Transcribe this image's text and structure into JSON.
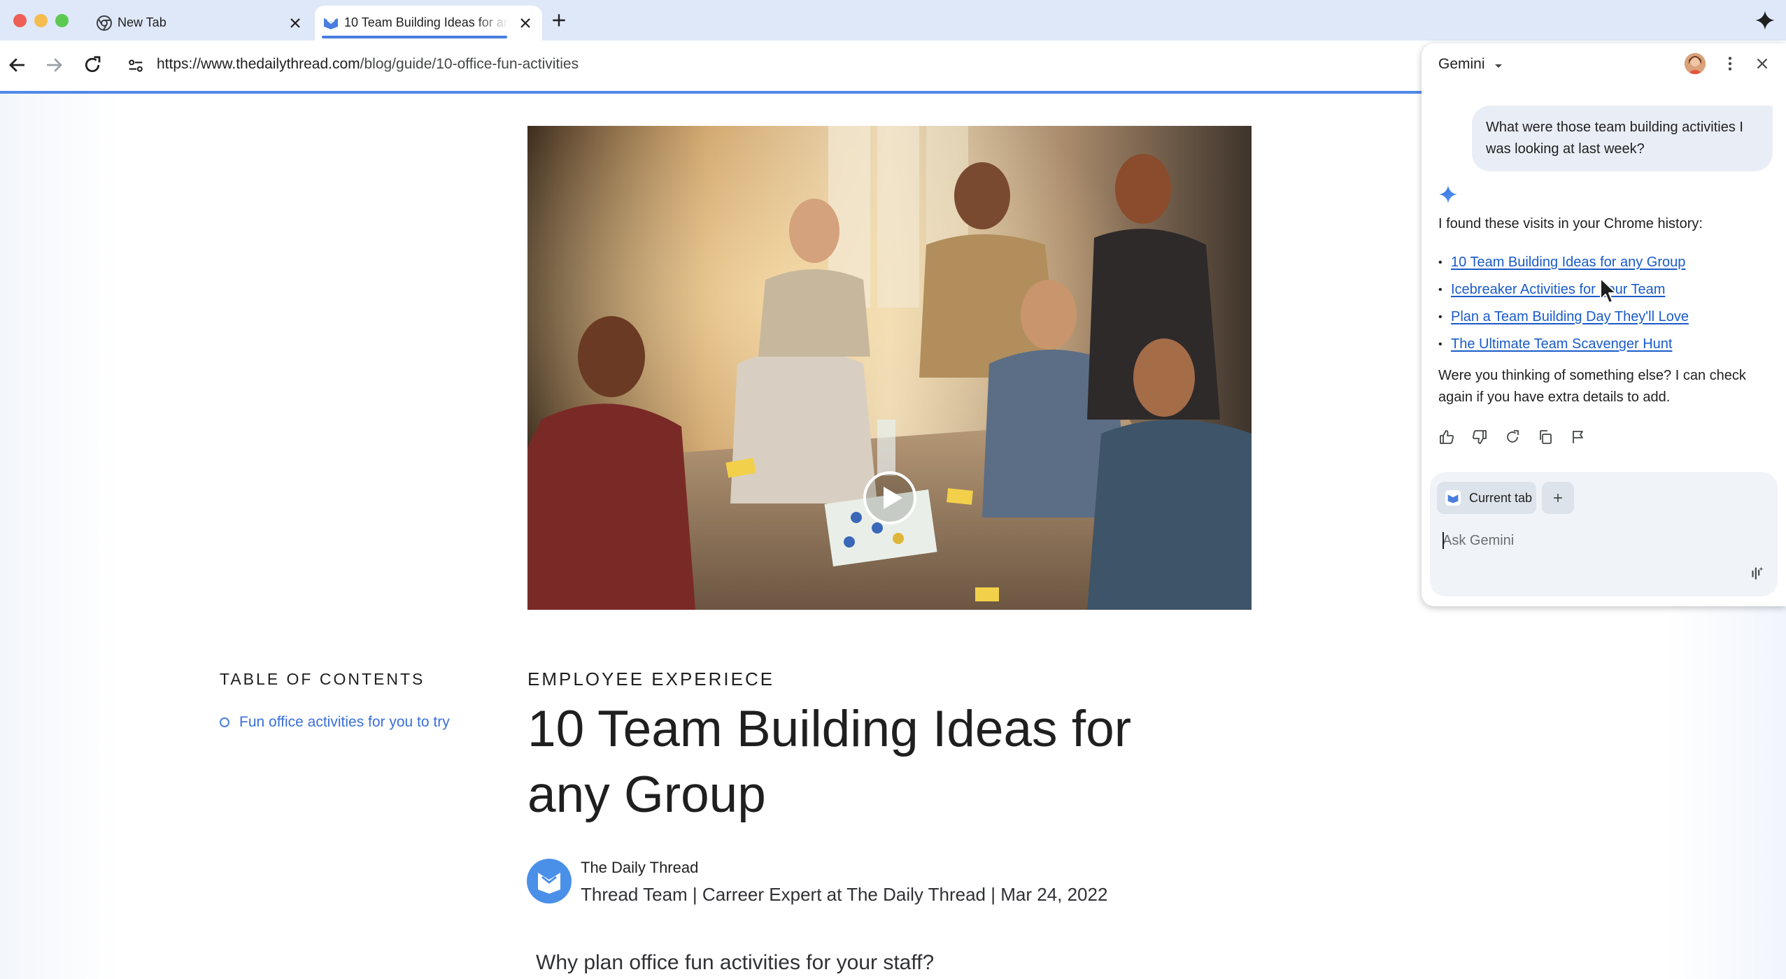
{
  "browser": {
    "tabs": [
      {
        "title": "New Tab",
        "active": false
      },
      {
        "title": "10 Team Building Ideas for any Group",
        "active": true
      }
    ],
    "url": {
      "host": "https://www.thedailythread.com",
      "path": "/blog/guide/10-office-fun-activities"
    }
  },
  "article": {
    "toc": {
      "heading": "TABLE OF CONTENTS",
      "items": [
        "Fun office activities for you to try"
      ]
    },
    "kicker": "EMPLOYEE EXPERIECE",
    "title": "10 Team Building Ideas for any Group",
    "author": {
      "name": "The Daily Thread",
      "meta": "Thread Team | Carreer Expert at The Daily Thread | Mar 24, 2022"
    },
    "subheading": "Why plan office fun activities for your staff?"
  },
  "gemini": {
    "title": "Gemini",
    "user_message": "What were those team building activities I was looking at last week?",
    "response_intro": "I found these visits in your Chrome history:",
    "links": [
      "10 Team Building Ideas for any Group",
      "Icebreaker Activities for Your Team",
      "Plan a Team Building Day They'll Love",
      "The Ultimate Team Scavenger Hunt"
    ],
    "followup": "Were you thinking of something else? I can check again if you have extra details to add.",
    "context_chip": "Current tab",
    "input_placeholder": "Ask Gemini"
  },
  "colors": {
    "accent": "#4a7de0",
    "link": "#1a5bc9",
    "tabstrip": "#dfe8f8",
    "panel_input": "#f0f4f9"
  }
}
